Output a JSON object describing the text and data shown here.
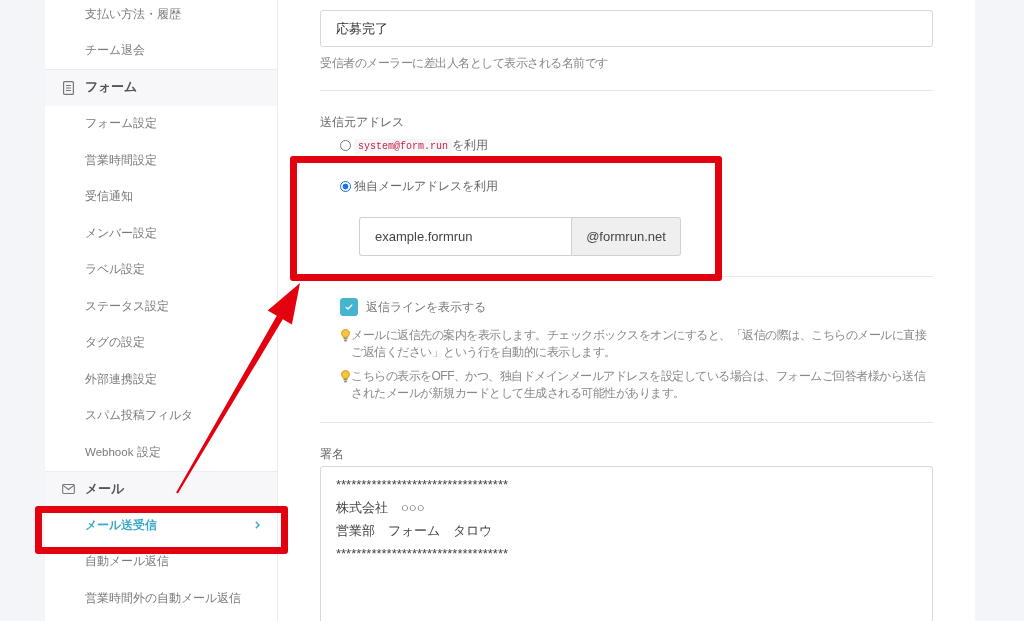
{
  "sidebar": {
    "sections": [
      {
        "items": [
          {
            "label": "支払い方法・履歴",
            "selected": false,
            "highlighted": false
          },
          {
            "label": "チーム退会",
            "selected": false,
            "highlighted": false
          }
        ]
      },
      {
        "title": "フォーム",
        "kind": "document",
        "items": [
          {
            "label": "フォーム設定",
            "selected": false,
            "highlighted": false
          },
          {
            "label": "営業時間設定",
            "selected": false,
            "highlighted": false
          },
          {
            "label": "受信通知",
            "selected": false,
            "highlighted": false
          },
          {
            "label": "メンバー設定",
            "selected": false,
            "highlighted": false
          },
          {
            "label": "ラベル設定",
            "selected": false,
            "highlighted": false
          },
          {
            "label": "ステータス設定",
            "selected": false,
            "highlighted": false
          },
          {
            "label": "タグの設定",
            "selected": false,
            "highlighted": false
          },
          {
            "label": "外部連携設定",
            "selected": false,
            "highlighted": false
          },
          {
            "label": "スパム投稿フィルタ",
            "selected": false,
            "highlighted": false
          },
          {
            "label": "Webhook 設定",
            "selected": false,
            "highlighted": false
          }
        ]
      },
      {
        "title": "メール",
        "kind": "mail",
        "items": [
          {
            "label": "メール送受信",
            "selected": true,
            "highlighted": true
          },
          {
            "label": "自動メール返信",
            "selected": false,
            "highlighted": false
          },
          {
            "label": "営業時間外の自動メール返信",
            "selected": false,
            "highlighted": false
          }
        ]
      }
    ]
  },
  "sender_name": {
    "value": "応募完了",
    "hint": "受信者のメーラーに差出人名として表示される名前です"
  },
  "sender_address": {
    "label": "送信元アドレス",
    "options": [
      {
        "code": "system@form.run",
        "label": "を利用",
        "selected": false,
        "highlighted": false
      },
      {
        "label": "独自メールアドレスを利用",
        "selected": true,
        "highlighted": true,
        "address": {
          "value": "example.formrun",
          "domain": "@formrun.net"
        }
      }
    ]
  },
  "reply_line": {
    "label": "返信ラインを表示する",
    "checked": true,
    "notes": [
      "メールに返信先の案内を表示します。チェックボックスをオンにすると、「返信の際は、こちらのメールに直接ご返信ください」という行を自動的に表示します。",
      "こちらの表示をOFF、かつ、独自ドメインメールアドレスを設定している場合は、フォームご回答者様から送信されたメールが新規カードとして生成される可能性があります。"
    ]
  },
  "signature": {
    "label": "署名",
    "lines": [
      "**********************************",
      "株式会社　○○○",
      "営業部　フォーム　タロウ",
      "**********************************"
    ]
  }
}
